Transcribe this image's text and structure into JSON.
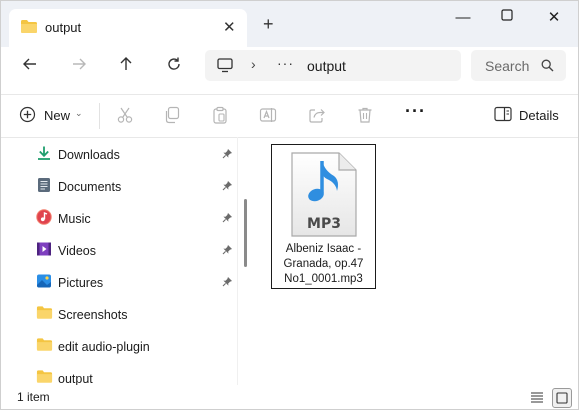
{
  "window": {
    "tab_title": "output",
    "new_tab_symbol": "+",
    "close_tab_symbol": "✕",
    "minimize_symbol": "—",
    "close_symbol": "✕"
  },
  "address": {
    "computer_icon": "computer-icon",
    "more_symbol": "···",
    "crumb": "output"
  },
  "search": {
    "placeholder": "Search"
  },
  "toolbar": {
    "new_label": "New",
    "more_symbol": "···",
    "details_label": "Details"
  },
  "sidebar": {
    "items": [
      {
        "label": "Downloads",
        "icon": "download-icon",
        "pinned": true
      },
      {
        "label": "Documents",
        "icon": "documents-icon",
        "pinned": true
      },
      {
        "label": "Music",
        "icon": "music-icon",
        "pinned": true
      },
      {
        "label": "Videos",
        "icon": "videos-icon",
        "pinned": true
      },
      {
        "label": "Pictures",
        "icon": "pictures-icon",
        "pinned": true
      },
      {
        "label": "Screenshots",
        "icon": "folder-icon",
        "pinned": false
      },
      {
        "label": "edit audio-plugin",
        "icon": "folder-icon",
        "pinned": false
      },
      {
        "label": "output",
        "icon": "folder-icon",
        "pinned": false
      }
    ]
  },
  "files": [
    {
      "name": "Albeniz Isaac - Granada, op.47 No1_0001.mp3",
      "badge": "MP3",
      "selected": true
    }
  ],
  "status": {
    "count": "1 item"
  },
  "colors": {
    "accent": "#0067c0",
    "folder": "#f4c542",
    "download_green": "#1f9e6e",
    "music_red": "#e0434e",
    "video_purple": "#7e3fbf",
    "pictures_blue": "#2a8ee6",
    "mp3_note_blue": "#2f8ee0"
  }
}
